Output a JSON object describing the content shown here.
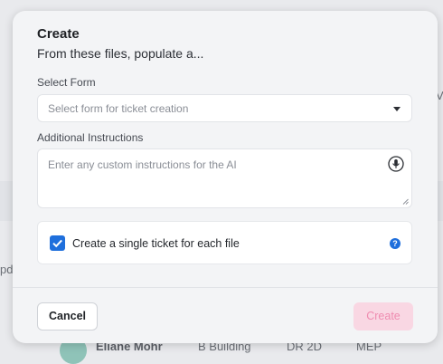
{
  "background": {
    "fragment_right": "V",
    "fragment_left": "pd",
    "row": {
      "name": "Eliane Mohr",
      "building": "B Building",
      "code": "DR 2D",
      "discipline": "MEP"
    }
  },
  "modal": {
    "title": "Create",
    "subtitle": "From these files, populate a...",
    "select_form": {
      "label": "Select Form",
      "placeholder": "Select form for ticket creation"
    },
    "additional_instructions": {
      "label": "Additional Instructions",
      "placeholder": "Enter any custom instructions for the AI"
    },
    "single_ticket_option": {
      "label": "Create a single ticket for each file",
      "checked": true,
      "help_glyph": "?"
    },
    "footer": {
      "cancel_label": "Cancel",
      "create_label": "Create"
    }
  },
  "colors": {
    "accent": "#1f6fdc",
    "create_disabled_bg": "#f9d7e3",
    "create_disabled_text": "#ef8bb0"
  }
}
